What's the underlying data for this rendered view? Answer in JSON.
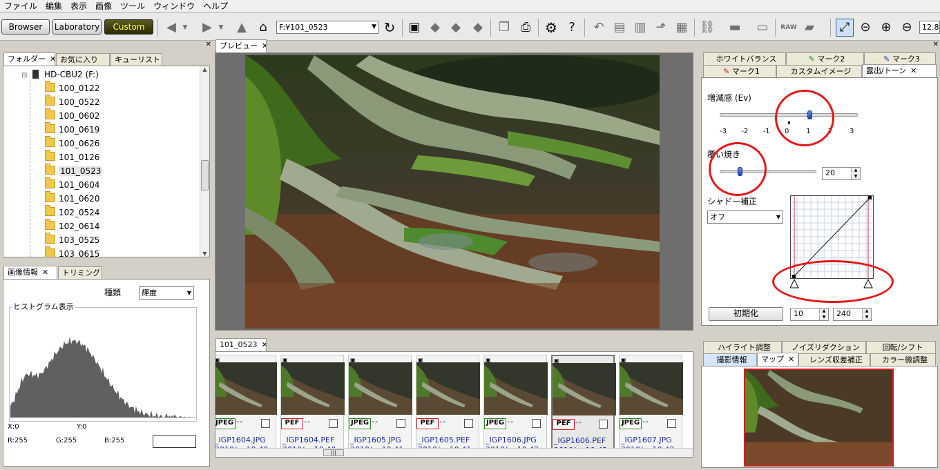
{
  "menu": [
    "ファイル",
    "編集",
    "表示",
    "画像",
    "ツール",
    "ウィンドウ",
    "ヘルプ"
  ],
  "toolbar": {
    "modes": [
      "Browser",
      "Laboratory",
      "Custom"
    ],
    "path": "F:¥101_0523",
    "zoom": "12.8"
  },
  "left_tabs": [
    {
      "label": "フォルダー"
    },
    {
      "label": "お気に入り"
    },
    {
      "label": "キューリスト"
    }
  ],
  "tree": {
    "drive": "HD-CBU2 (F:)",
    "folders": [
      "100_0122",
      "100_0522",
      "100_0602",
      "100_0619",
      "100_0626",
      "101_0126",
      "101_0523",
      "101_0604",
      "101_0620",
      "102_0524",
      "102_0614",
      "103_0525",
      "103_0615"
    ],
    "selected_index": 6
  },
  "info_tabs": [
    {
      "label": "画像情報"
    },
    {
      "label": "トリミング"
    }
  ],
  "histogram": {
    "type_label": "種類",
    "type_value": "輝度",
    "title": "ヒストグラム表示",
    "x_label": "X:0",
    "y_label": "Y:0",
    "r": "R:255",
    "g": "G:255",
    "b": "B:255"
  },
  "preview_tab": "プレビュー",
  "thumb_tab": "101_0523",
  "thumbnails": [
    {
      "format": "JPEG",
      "kind": "jpeg",
      "name": "_IGP1604.JPG",
      "date": "2010/... 10:40:..."
    },
    {
      "format": "PEF",
      "kind": "pef",
      "name": "_IGP1604.PEF",
      "date": "2010/... 10:40:..."
    },
    {
      "format": "JPEG",
      "kind": "jpeg",
      "name": "_IGP1605.JPG",
      "date": "2010/... 10:41:..."
    },
    {
      "format": "PEF",
      "kind": "pef",
      "name": "_IGP1605.PEF",
      "date": "2010/... 10:41:..."
    },
    {
      "format": "JPEG",
      "kind": "jpeg",
      "name": "_IGP1606.JPG",
      "date": "2010/... 10:42:..."
    },
    {
      "format": "PEF",
      "kind": "pef",
      "name": "_IGP1606.PEF",
      "date": "2010/... 10:42:..."
    },
    {
      "format": "JPEG",
      "kind": "jpeg",
      "name": "_IGP1607.JPG",
      "date": "2010/... 10:42:..."
    }
  ],
  "right_tabs_row1": [
    {
      "label": "ホワイトバランス"
    },
    {
      "label": "マーク2"
    },
    {
      "label": "マーク3"
    }
  ],
  "right_tabs_row2": [
    {
      "label": "マーク1"
    },
    {
      "label": "カスタムイメージ"
    },
    {
      "label": "露出/トーン"
    }
  ],
  "exposure": {
    "ev_label": "増減感 (Ev)",
    "ev_ticks": [
      "-3",
      "-2",
      "-1",
      "0",
      "1",
      "2",
      "3"
    ],
    "ev_value": 1.0,
    "burn_label": "覆い焼き",
    "burn_value": "20",
    "shadow_label": "シャドー補正",
    "shadow_value": "オフ",
    "reset_label": "初期化",
    "low_value": "10",
    "high_value": "240"
  },
  "bottom_tabs_row1": [
    {
      "label": "ハイライト調整"
    },
    {
      "label": "ノイズリダクション"
    },
    {
      "label": "回転/シフト"
    }
  ],
  "bottom_tabs_row2": [
    {
      "label": "撮影情報"
    },
    {
      "label": "マップ"
    },
    {
      "label": "レンズ収差補正"
    },
    {
      "label": "カラー微調整"
    }
  ]
}
